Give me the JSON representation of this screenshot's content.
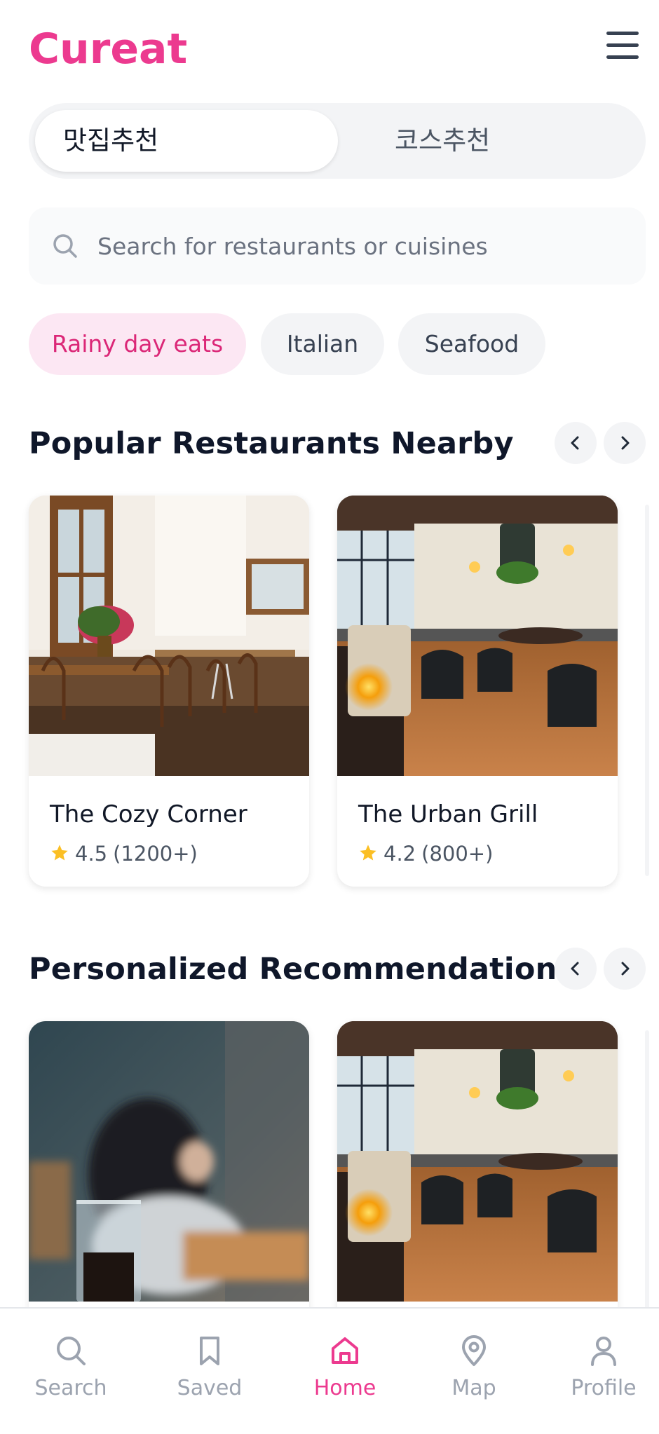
{
  "app": {
    "brand": "Cureat"
  },
  "header": {
    "menu_icon": "hamburger-menu-icon"
  },
  "segment": {
    "tabs": [
      {
        "label": "맛집추천",
        "active": true
      },
      {
        "label": "코스추천",
        "active": false
      }
    ]
  },
  "search": {
    "placeholder": "Search for restaurants or cuisines",
    "value": "",
    "icon": "search-icon"
  },
  "chips": [
    {
      "label": "Rainy day eats",
      "active": true
    },
    {
      "label": "Italian",
      "active": false
    },
    {
      "label": "Seafood",
      "active": false
    }
  ],
  "sections": [
    {
      "title": "Popular Restaurants Nearby",
      "cards": [
        {
          "name": "The Cozy Corner",
          "rating": "4.5",
          "reviews": "(1200+)",
          "photo": "bright-cafe-interior"
        },
        {
          "name": "The Urban Grill",
          "rating": "4.2",
          "reviews": "(800+)",
          "photo": "modern-dining-room-candle"
        }
      ]
    },
    {
      "title": "Personalized Recommendations",
      "cards": [
        {
          "name": "",
          "rating": "",
          "reviews": "",
          "photo": "blurred-person-coffee"
        },
        {
          "name": "",
          "rating": "",
          "reviews": "",
          "photo": "modern-dining-room-candle"
        }
      ]
    }
  ],
  "bottom_nav": [
    {
      "label": "Search",
      "icon": "search-icon",
      "active": false
    },
    {
      "label": "Saved",
      "icon": "bookmark-icon",
      "active": false
    },
    {
      "label": "Home",
      "icon": "home-icon",
      "active": true
    },
    {
      "label": "Map",
      "icon": "map-pin-icon",
      "active": false
    },
    {
      "label": "Profile",
      "icon": "user-icon",
      "active": false
    }
  ],
  "colors": {
    "brand": "#ec3a8f",
    "chip_active_bg": "#fce7f3",
    "star": "#fbbf24"
  }
}
